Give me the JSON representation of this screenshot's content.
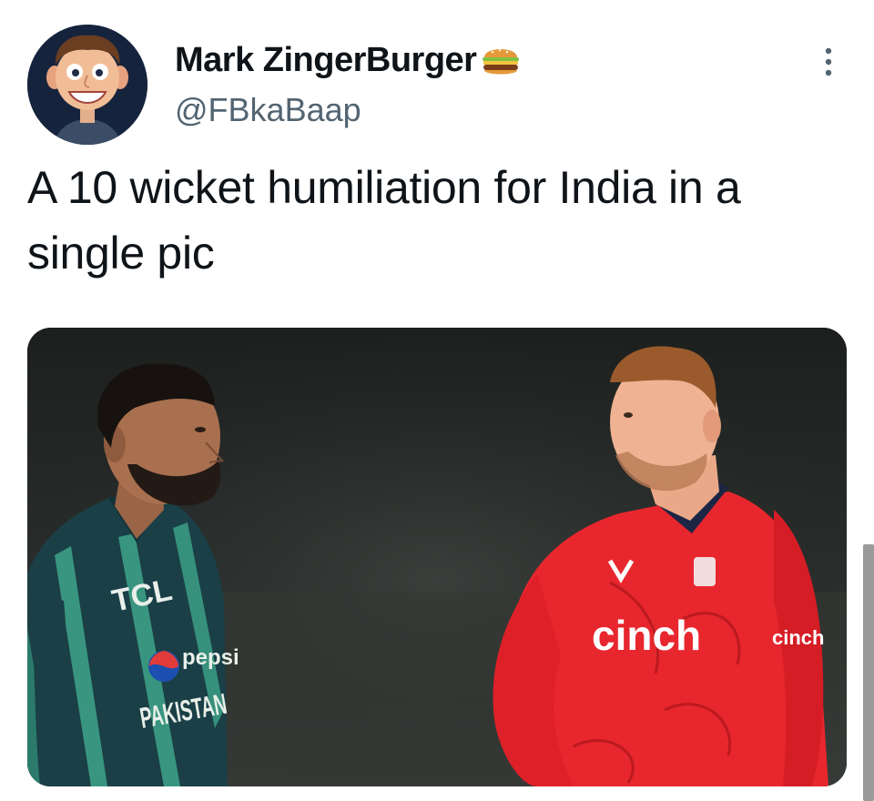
{
  "tweet": {
    "author": {
      "display_name": "Mark ZingerBurger",
      "name_emoji": "hamburger-emoji",
      "handle": "@FBkaBaap",
      "avatar": "caricature-avatar"
    },
    "more_icon": "more-options-icon",
    "text": "A 10 wicket humiliation for India in a single pic",
    "media": {
      "type": "photo",
      "jersey_left": {
        "sponsor_top": "TCL",
        "sponsor_mid": "pepsi",
        "team": "PAKISTAN"
      },
      "jersey_right": {
        "sponsor": "cinch",
        "sleeve": "cinch"
      }
    }
  },
  "colors": {
    "text_primary": "#0f1419",
    "text_secondary": "#536471",
    "england_red": "#e8262e",
    "pakistan_green": "#1c4d4a",
    "background": "#ffffff"
  }
}
